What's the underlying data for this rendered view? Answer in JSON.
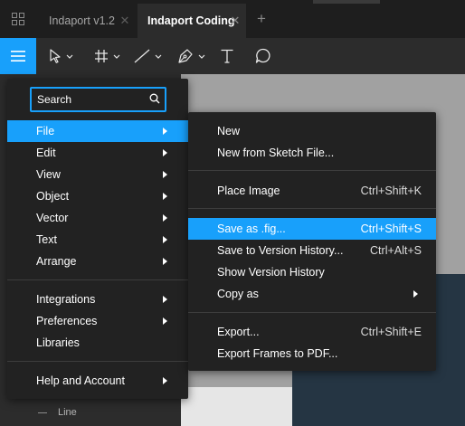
{
  "tabs": [
    {
      "label": "Indaport v1.2",
      "active": false
    },
    {
      "label": "Indaport Coding",
      "active": true
    }
  ],
  "toolbar": {
    "tools": [
      "move-tool",
      "frame-tool",
      "line-tool",
      "pen-tool",
      "text-tool",
      "comment-tool"
    ]
  },
  "search": {
    "placeholder": "Search"
  },
  "main_menu": {
    "items": [
      {
        "label": "File",
        "submenu": true,
        "active": true
      },
      {
        "label": "Edit",
        "submenu": true
      },
      {
        "label": "View",
        "submenu": true
      },
      {
        "label": "Object",
        "submenu": true
      },
      {
        "label": "Vector",
        "submenu": true
      },
      {
        "label": "Text",
        "submenu": true
      },
      {
        "label": "Arrange",
        "submenu": true
      },
      {
        "label": "Integrations",
        "submenu": true
      },
      {
        "label": "Preferences",
        "submenu": true
      },
      {
        "label": "Libraries",
        "submenu": false
      },
      {
        "label": "Help and Account",
        "submenu": true
      }
    ]
  },
  "file_menu": {
    "items": [
      {
        "label": "New",
        "shortcut": ""
      },
      {
        "label": "New from Sketch File...",
        "shortcut": ""
      },
      {
        "label": "Place Image",
        "shortcut": "Ctrl+Shift+K"
      },
      {
        "label": "Save as .fig...",
        "shortcut": "Ctrl+Shift+S",
        "active": true
      },
      {
        "label": "Save to Version History...",
        "shortcut": "Ctrl+Alt+S"
      },
      {
        "label": "Show Version History",
        "shortcut": ""
      },
      {
        "label": "Copy as",
        "shortcut": "",
        "submenu": true
      },
      {
        "label": "Export...",
        "shortcut": "Ctrl+Shift+E"
      },
      {
        "label": "Export Frames to PDF...",
        "shortcut": ""
      }
    ]
  },
  "layers": {
    "line_label": "Line"
  },
  "colors": {
    "accent": "#18a0fb",
    "menu_bg": "#222222",
    "toolbar_bg": "#2c2c2c",
    "tabbar_bg": "#1e1e1e"
  }
}
